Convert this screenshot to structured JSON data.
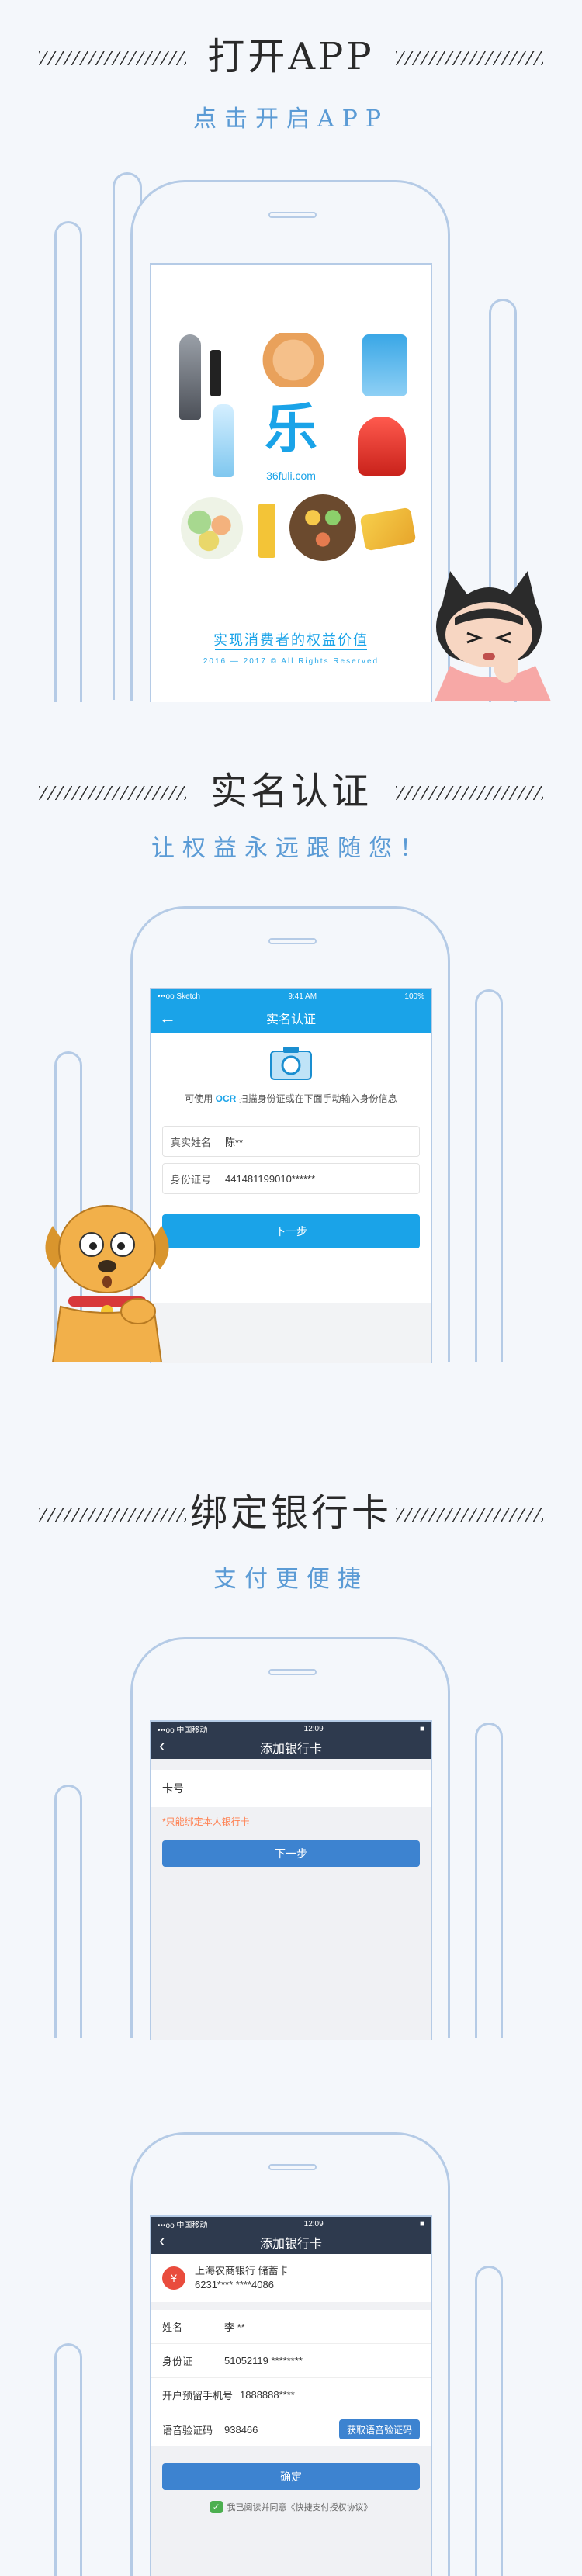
{
  "sections": [
    {
      "title": "打开APP",
      "subtitle": "点击开启APP"
    },
    {
      "title": "实名认证",
      "subtitle": "让权益永远跟随您！"
    },
    {
      "title": "绑定银行卡",
      "subtitle": "支付更便捷"
    }
  ],
  "splash": {
    "logo": "乐",
    "site": "36fuli.com",
    "slogan": "实现消费者的权益价值",
    "copyright": "2016 — 2017 © All Rights Reserved"
  },
  "verify": {
    "status": {
      "carrier": "•••oo Sketch",
      "time": "9:41 AM",
      "battery": "100%"
    },
    "title": "实名认证",
    "hint_pre": "可使用",
    "hint_ocr": "OCR",
    "hint_post": "扫描身份证或在下面手动输入身份信息",
    "name_label": "真实姓名",
    "name_value": "陈**",
    "id_label": "身份证号",
    "id_value": "441481199010******",
    "next": "下一步"
  },
  "bind": {
    "status": {
      "carrier": "•••oo 中国移动",
      "time": "12:09",
      "battery": "■"
    },
    "title": "添加银行卡",
    "card_label": "卡号",
    "notice": "*只能绑定本人银行卡",
    "next": "下一步"
  },
  "confirm": {
    "status": {
      "carrier": "•••oo 中国移动",
      "time": "12:09",
      "battery": "■"
    },
    "title": "添加银行卡",
    "bank_name": "上海农商银行 储蓄卡",
    "bank_no": "6231**** ****4086",
    "fields": [
      {
        "label": "姓名",
        "value": "李 **"
      },
      {
        "label": "身份证",
        "value": "51052119 ********"
      },
      {
        "label": "开户预留手机号",
        "value": "1888888****"
      },
      {
        "label": "语音验证码",
        "value": "938466"
      }
    ],
    "get_code": "获取语音验证码",
    "confirm": "确定",
    "agree": "我已阅读并同意《快捷支付授权协议》"
  },
  "colors": {
    "accent": "#1aa3e8",
    "phone": "#b5cbe6",
    "dark_nav": "#2e3a4e",
    "button_blue": "#3d83d0",
    "notice": "#ff7f4f"
  }
}
